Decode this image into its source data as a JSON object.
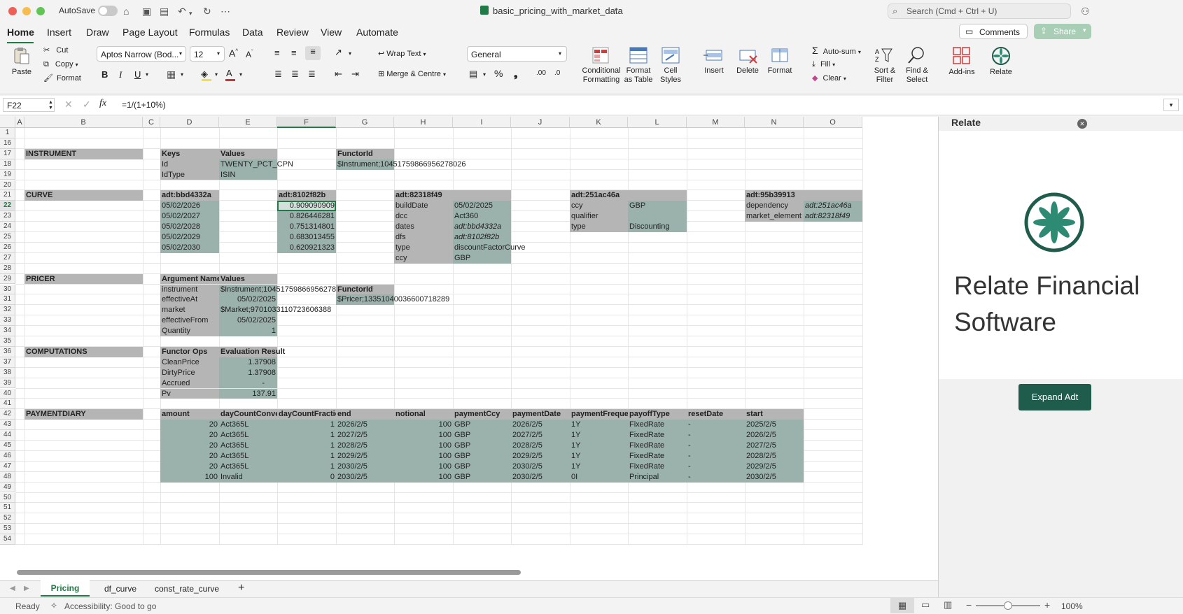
{
  "window": {
    "autosave": "AutoSave",
    "filename": "basic_pricing_with_market_data",
    "search_placeholder": "Search (Cmd + Ctrl + U)"
  },
  "tabs": [
    "Home",
    "Insert",
    "Draw",
    "Page Layout",
    "Formulas",
    "Data",
    "Review",
    "View",
    "Automate"
  ],
  "buttons": {
    "comments": "Comments",
    "share": "Share"
  },
  "clipboard": {
    "paste": "Paste",
    "cut": "Cut",
    "copy": "Copy",
    "format": "Format"
  },
  "font": {
    "name": "Aptos Narrow (Bod...",
    "size": "12"
  },
  "alignment": {
    "wrap": "Wrap Text",
    "merge": "Merge & Centre"
  },
  "number": {
    "format": "General"
  },
  "styles": {
    "conditional": "Conditional Formatting",
    "format_table": "Format as Table",
    "cell_styles": "Cell Styles"
  },
  "cells_group": {
    "insert": "Insert",
    "delete": "Delete",
    "format": "Format"
  },
  "editing": {
    "autosum": "Auto-sum",
    "fill": "Fill",
    "clear": "Clear",
    "sort": "Sort & Filter",
    "find": "Find & Select"
  },
  "addins": {
    "addins": "Add-ins",
    "relate": "Relate"
  },
  "formula_bar": {
    "name_box": "F22",
    "formula": "=1/(1+10%)"
  },
  "columns": [
    "A",
    "B",
    "C",
    "D",
    "E",
    "F",
    "G",
    "H",
    "I",
    "J",
    "K",
    "L",
    "M",
    "N",
    "O"
  ],
  "rows": [
    "1",
    "16",
    "17",
    "18",
    "19",
    "20",
    "21",
    "22",
    "23",
    "24",
    "25",
    "26",
    "27",
    "28",
    "29",
    "30",
    "31",
    "32",
    "33",
    "34",
    "35",
    "36",
    "37",
    "38",
    "39",
    "40",
    "41",
    "42",
    "43",
    "44",
    "45",
    "46",
    "47",
    "48",
    "49",
    "50",
    "51",
    "52",
    "53",
    "54"
  ],
  "cells": {
    "instrument": "INSTRUMENT",
    "keys": "Keys",
    "values": "Values",
    "functorid": "FunctorId",
    "id": "Id",
    "idval": "TWENTY_PCT_CPN",
    "instr_fid": "$Instrument;10451759866956278026",
    "idtype": "IdType",
    "isin": "ISIN",
    "curve": "CURVE",
    "adt1": "adt:bbd4332a",
    "adt2": "adt:8102f82b",
    "adt3": "adt:82318f49",
    "adt4": "adt:251ac46a",
    "adt5": "adt:95b39913",
    "d1": "05/02/2026",
    "d2": "05/02/2027",
    "d3": "05/02/2028",
    "d4": "05/02/2029",
    "d5": "05/02/2030",
    "f1": "0.909090909",
    "f2": "0.826446281",
    "f3": "0.751314801",
    "f4": "0.683013455",
    "f5": "0.620921323",
    "builddate": "buildDate",
    "builddate_v": "05/02/2025",
    "dcc": "dcc",
    "dcc_v": "Act360",
    "dates": "dates",
    "dates_v": "adt:bbd4332a",
    "dfs": "dfs",
    "dfs_v": "adt:8102f82b",
    "type": "type",
    "type_v": "discountFactorCurve",
    "ccy": "ccy",
    "ccy_v": "GBP",
    "k_ccy": "ccy",
    "k_ccy_v": "GBP",
    "k_qual": "qualifier",
    "k_type": "type",
    "k_type_v": "Discounting",
    "dependency": "dependency",
    "dependency_v": "adt:251ac46a",
    "market_el": "market_element",
    "market_el_v": "adt:82318f49",
    "pricer": "PRICER",
    "argnames": "Argument Names",
    "values2": "Values",
    "p_instr": "instrument",
    "p_instr_v": "$Instrument;10451759866956278026",
    "functorid2": "FunctorId",
    "p_eff": "effectiveAt",
    "p_eff_v": "05/02/2025",
    "pricer_fid": "$Pricer;13351040036600718289",
    "p_market": "market",
    "p_market_v": "$Market;9701033110723606388",
    "p_efrom": "effectiveFrom",
    "p_efrom_v": "05/02/2025",
    "p_qty": "Quantity",
    "p_qty_v": "1",
    "computations": "COMPUTATIONS",
    "functorops": "Functor Ops",
    "evalresult": "Evaluation Result",
    "clean": "CleanPrice",
    "clean_v": "1.37908",
    "dirty": "DirtyPrice",
    "dirty_v": "1.37908",
    "accrued": "Accrued",
    "accrued_v": "-",
    "pv": "Pv",
    "pv_v": "137.91",
    "paymentdiary": "PAYMENTDIARY"
  },
  "diary": {
    "headers": [
      "amount",
      "dayCountConvention",
      "dayCountFraction",
      "end",
      "notional",
      "paymentCcy",
      "paymentDate",
      "paymentFrequency",
      "payoffType",
      "resetDate",
      "start"
    ],
    "rows": [
      [
        "20",
        "Act365L",
        "1",
        "2026/2/5",
        "100",
        "GBP",
        "2026/2/5",
        "1Y",
        "FixedRate",
        "-",
        "2025/2/5"
      ],
      [
        "20",
        "Act365L",
        "1",
        "2027/2/5",
        "100",
        "GBP",
        "2027/2/5",
        "1Y",
        "FixedRate",
        "-",
        "2026/2/5"
      ],
      [
        "20",
        "Act365L",
        "1",
        "2028/2/5",
        "100",
        "GBP",
        "2028/2/5",
        "1Y",
        "FixedRate",
        "-",
        "2027/2/5"
      ],
      [
        "20",
        "Act365L",
        "1",
        "2029/2/5",
        "100",
        "GBP",
        "2029/2/5",
        "1Y",
        "FixedRate",
        "-",
        "2028/2/5"
      ],
      [
        "20",
        "Act365L",
        "1",
        "2030/2/5",
        "100",
        "GBP",
        "2030/2/5",
        "1Y",
        "FixedRate",
        "-",
        "2029/2/5"
      ],
      [
        "100",
        "Invalid",
        "0",
        "2030/2/5",
        "100",
        "GBP",
        "2030/2/5",
        "0I",
        "Principal",
        "-",
        "2030/2/5"
      ]
    ]
  },
  "sheets": [
    "Pricing",
    "df_curve",
    "const_rate_curve"
  ],
  "status": {
    "ready": "Ready",
    "accessibility": "Accessibility: Good to go",
    "zoom": "100%"
  },
  "pane": {
    "title": "Relate",
    "brand": "Relate Financial Software",
    "expand": "Expand Adt"
  }
}
